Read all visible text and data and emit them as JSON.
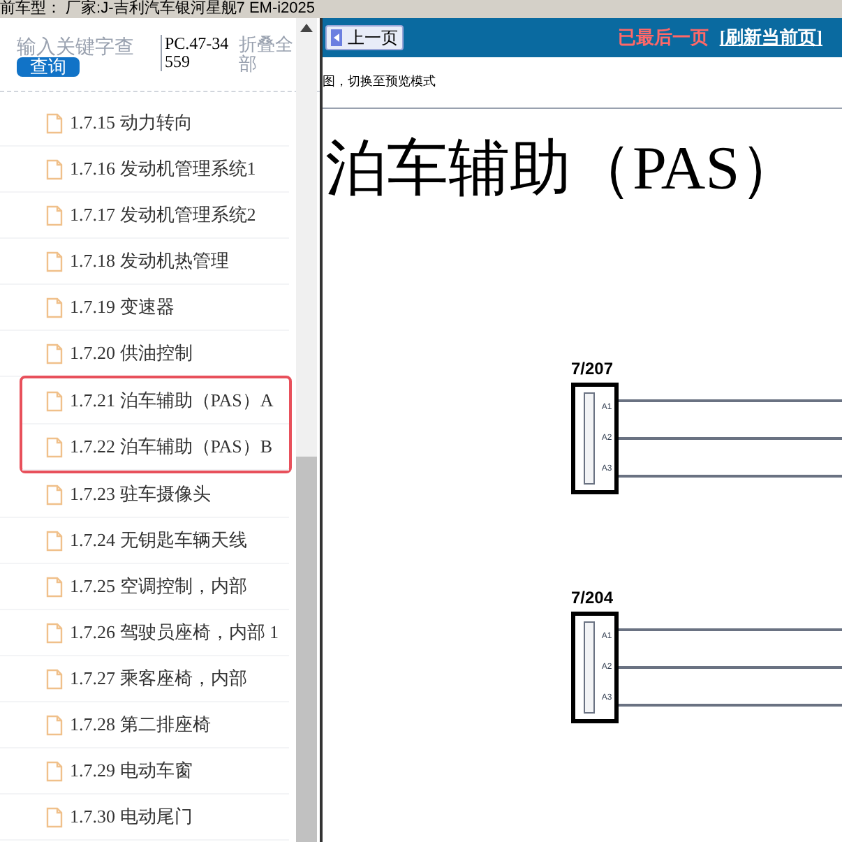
{
  "top_bar": {
    "text": "前车型： 厂家:J-吉利汽车银河星舰7 EM-i2025"
  },
  "sidebar": {
    "search": {
      "placeholder": "输入关键字查"
    },
    "search_button": "查询",
    "code": "PC.47-34559",
    "collapse_all": "折叠全部",
    "items": [
      {
        "label": "1.7.15 动力转向",
        "highlighted": false
      },
      {
        "label": "1.7.16 发动机管理系统1",
        "highlighted": false
      },
      {
        "label": "1.7.17 发动机管理系统2",
        "highlighted": false
      },
      {
        "label": "1.7.18 发动机热管理",
        "highlighted": false
      },
      {
        "label": "1.7.19 变速器",
        "highlighted": false
      },
      {
        "label": "1.7.20 供油控制",
        "highlighted": false
      },
      {
        "label": "1.7.21 泊车辅助（PAS）A",
        "highlighted": true
      },
      {
        "label": "1.7.22 泊车辅助（PAS）B",
        "highlighted": true
      },
      {
        "label": "1.7.23 驻车摄像头",
        "highlighted": false
      },
      {
        "label": "1.7.24 无钥匙车辆天线",
        "highlighted": false
      },
      {
        "label": "1.7.25 空调控制，内部",
        "highlighted": false
      },
      {
        "label": "1.7.26 驾驶员座椅，内部 1",
        "highlighted": false
      },
      {
        "label": "1.7.27 乘客座椅，内部",
        "highlighted": false
      },
      {
        "label": "1.7.28 第二排座椅",
        "highlighted": false
      },
      {
        "label": "1.7.29 电动车窗",
        "highlighted": false
      },
      {
        "label": "1.7.30 电动尾门",
        "highlighted": false
      }
    ]
  },
  "content": {
    "prev_button": "上一页",
    "last_page_notice": "已最后一页",
    "refresh_link": "[刷新当前页]",
    "hint": "图，切换至预览模式",
    "title": "泊车辅助（PAS）",
    "connectors": [
      {
        "label": "7/207",
        "pins": [
          "A1",
          "A2",
          "A3"
        ]
      },
      {
        "label": "7/204",
        "pins": [
          "A1",
          "A2",
          "A3"
        ]
      }
    ]
  }
}
